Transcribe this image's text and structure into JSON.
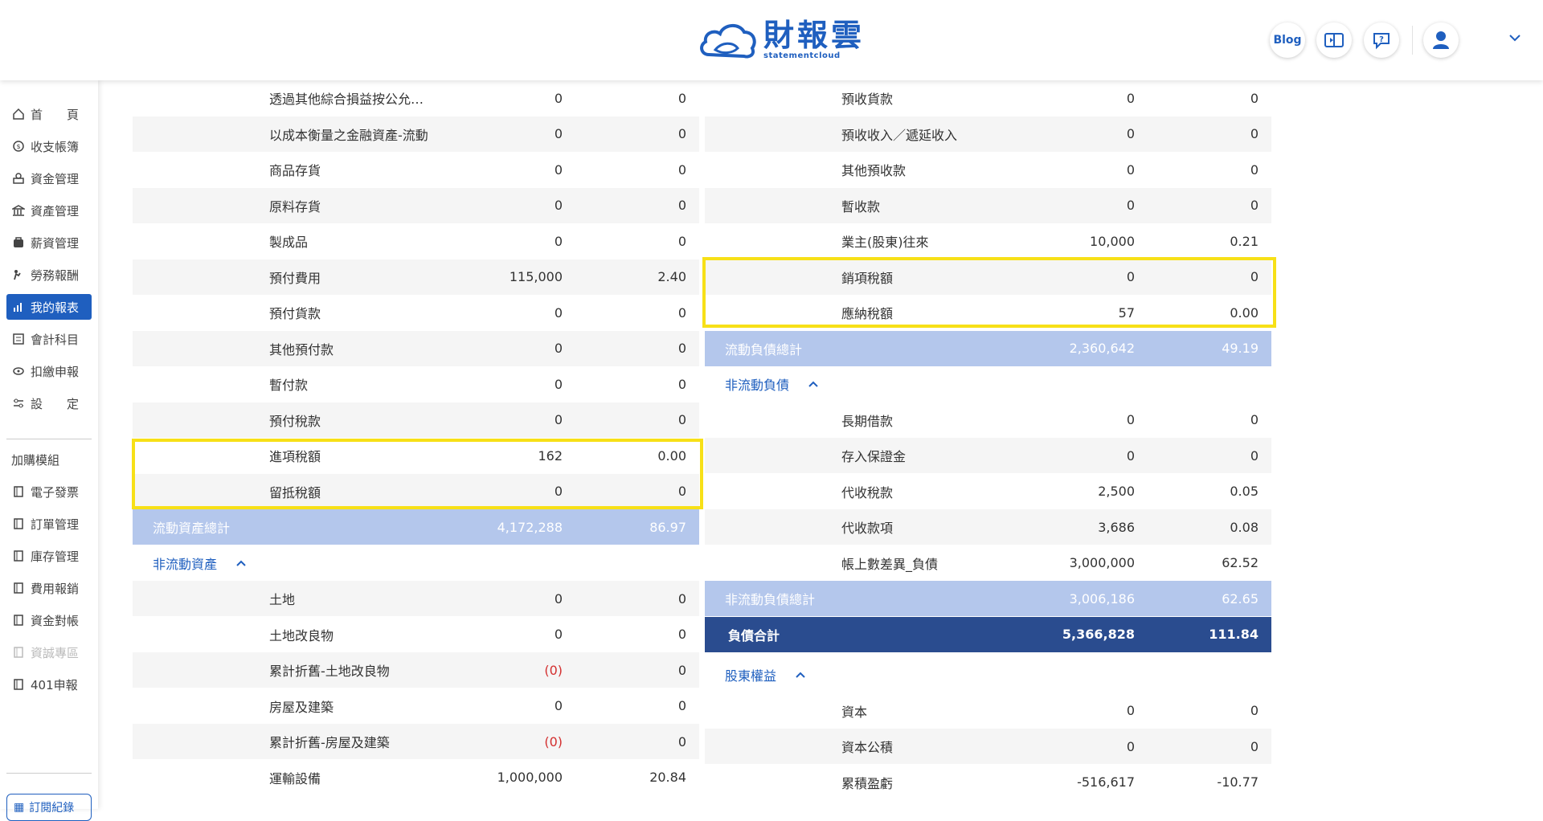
{
  "header": {
    "logo_main": "財報雲",
    "logo_sub": "statementcloud",
    "blog_label": "Blog"
  },
  "sidebar": {
    "items": [
      {
        "label": "首　　頁",
        "icon": "home-icon"
      },
      {
        "label": "收支帳簿",
        "icon": "coin-icon"
      },
      {
        "label": "資金管理",
        "icon": "funds-icon"
      },
      {
        "label": "資產管理",
        "icon": "bank-icon"
      },
      {
        "label": "薪資管理",
        "icon": "payroll-icon"
      },
      {
        "label": "勞務報酬",
        "icon": "labor-icon"
      },
      {
        "label": "我的報表",
        "icon": "chart-icon"
      },
      {
        "label": "會計科目",
        "icon": "ledger-icon"
      },
      {
        "label": "扣繳申報",
        "icon": "withhold-icon"
      },
      {
        "label": "設　　定",
        "icon": "settings-icon"
      }
    ],
    "group_title": "加購模組",
    "modules": [
      {
        "label": "電子發票"
      },
      {
        "label": "訂單管理"
      },
      {
        "label": "庫存管理"
      },
      {
        "label": "費用報銷"
      },
      {
        "label": "資金對帳"
      },
      {
        "label": "資誠專區"
      },
      {
        "label": "401申報"
      }
    ],
    "subscription_label": "訂閱紀錄"
  },
  "left_table": {
    "rows_top": [
      {
        "label": "透過其他綜合損益按公允…",
        "amount": "0",
        "percent": "0"
      },
      {
        "label": "以成本衡量之金融資產-流動",
        "amount": "0",
        "percent": "0"
      },
      {
        "label": "商品存貨",
        "amount": "0",
        "percent": "0"
      },
      {
        "label": "原料存貨",
        "amount": "0",
        "percent": "0"
      },
      {
        "label": "製成品",
        "amount": "0",
        "percent": "0"
      },
      {
        "label": "預付費用",
        "amount": "115,000",
        "percent": "2.40"
      },
      {
        "label": "預付貨款",
        "amount": "0",
        "percent": "0"
      },
      {
        "label": "其他預付款",
        "amount": "0",
        "percent": "0"
      },
      {
        "label": "暫付款",
        "amount": "0",
        "percent": "0"
      },
      {
        "label": "預付稅款",
        "amount": "0",
        "percent": "0"
      },
      {
        "label": "進項稅額",
        "amount": "162",
        "percent": "0.00"
      },
      {
        "label": "留抵稅額",
        "amount": "0",
        "percent": "0"
      }
    ],
    "current_total": {
      "label": "流動資產總計",
      "amount": "4,172,288",
      "percent": "86.97"
    },
    "noncurrent_title": "非流動資產",
    "rows_bottom": [
      {
        "label": "土地",
        "amount": "0",
        "percent": "0"
      },
      {
        "label": "土地改良物",
        "amount": "0",
        "percent": "0"
      },
      {
        "label": "累計折舊-土地改良物",
        "amount": "(0)",
        "percent": "0"
      },
      {
        "label": "房屋及建築",
        "amount": "0",
        "percent": "0"
      },
      {
        "label": "累計折舊-房屋及建築",
        "amount": "(0)",
        "percent": "0"
      },
      {
        "label": "運輸設備",
        "amount": "1,000,000",
        "percent": "20.84"
      }
    ]
  },
  "right_table": {
    "rows_top": [
      {
        "label": "預收貨款",
        "amount": "0",
        "percent": "0"
      },
      {
        "label": "預收收入／遞延收入",
        "amount": "0",
        "percent": "0"
      },
      {
        "label": "其他預收款",
        "amount": "0",
        "percent": "0"
      },
      {
        "label": "暫收款",
        "amount": "0",
        "percent": "0"
      },
      {
        "label": "業主(股東)往來",
        "amount": "10,000",
        "percent": "0.21"
      },
      {
        "label": "銷項稅額",
        "amount": "0",
        "percent": "0"
      },
      {
        "label": "應納稅額",
        "amount": "57",
        "percent": "0.00"
      }
    ],
    "current_total": {
      "label": "流動負債總計",
      "amount": "2,360,642",
      "percent": "49.19"
    },
    "noncurrent_title": "非流動負債",
    "rows_mid": [
      {
        "label": "長期借款",
        "amount": "0",
        "percent": "0"
      },
      {
        "label": "存入保證金",
        "amount": "0",
        "percent": "0"
      },
      {
        "label": "代收稅款",
        "amount": "2,500",
        "percent": "0.05"
      },
      {
        "label": "代收款項",
        "amount": "3,686",
        "percent": "0.08"
      },
      {
        "label": "帳上數差異_負債",
        "amount": "3,000,000",
        "percent": "62.52"
      }
    ],
    "noncurrent_total": {
      "label": "非流動負債總計",
      "amount": "3,006,186",
      "percent": "62.65"
    },
    "liability_total": {
      "label": "負債合計",
      "amount": "5,366,828",
      "percent": "111.84"
    },
    "equity_title": "股東權益",
    "rows_equity": [
      {
        "label": "資本",
        "amount": "0",
        "percent": "0"
      },
      {
        "label": "資本公積",
        "amount": "0",
        "percent": "0"
      },
      {
        "label": "累積盈虧",
        "amount": "-516,617",
        "percent": "-10.77"
      }
    ]
  }
}
